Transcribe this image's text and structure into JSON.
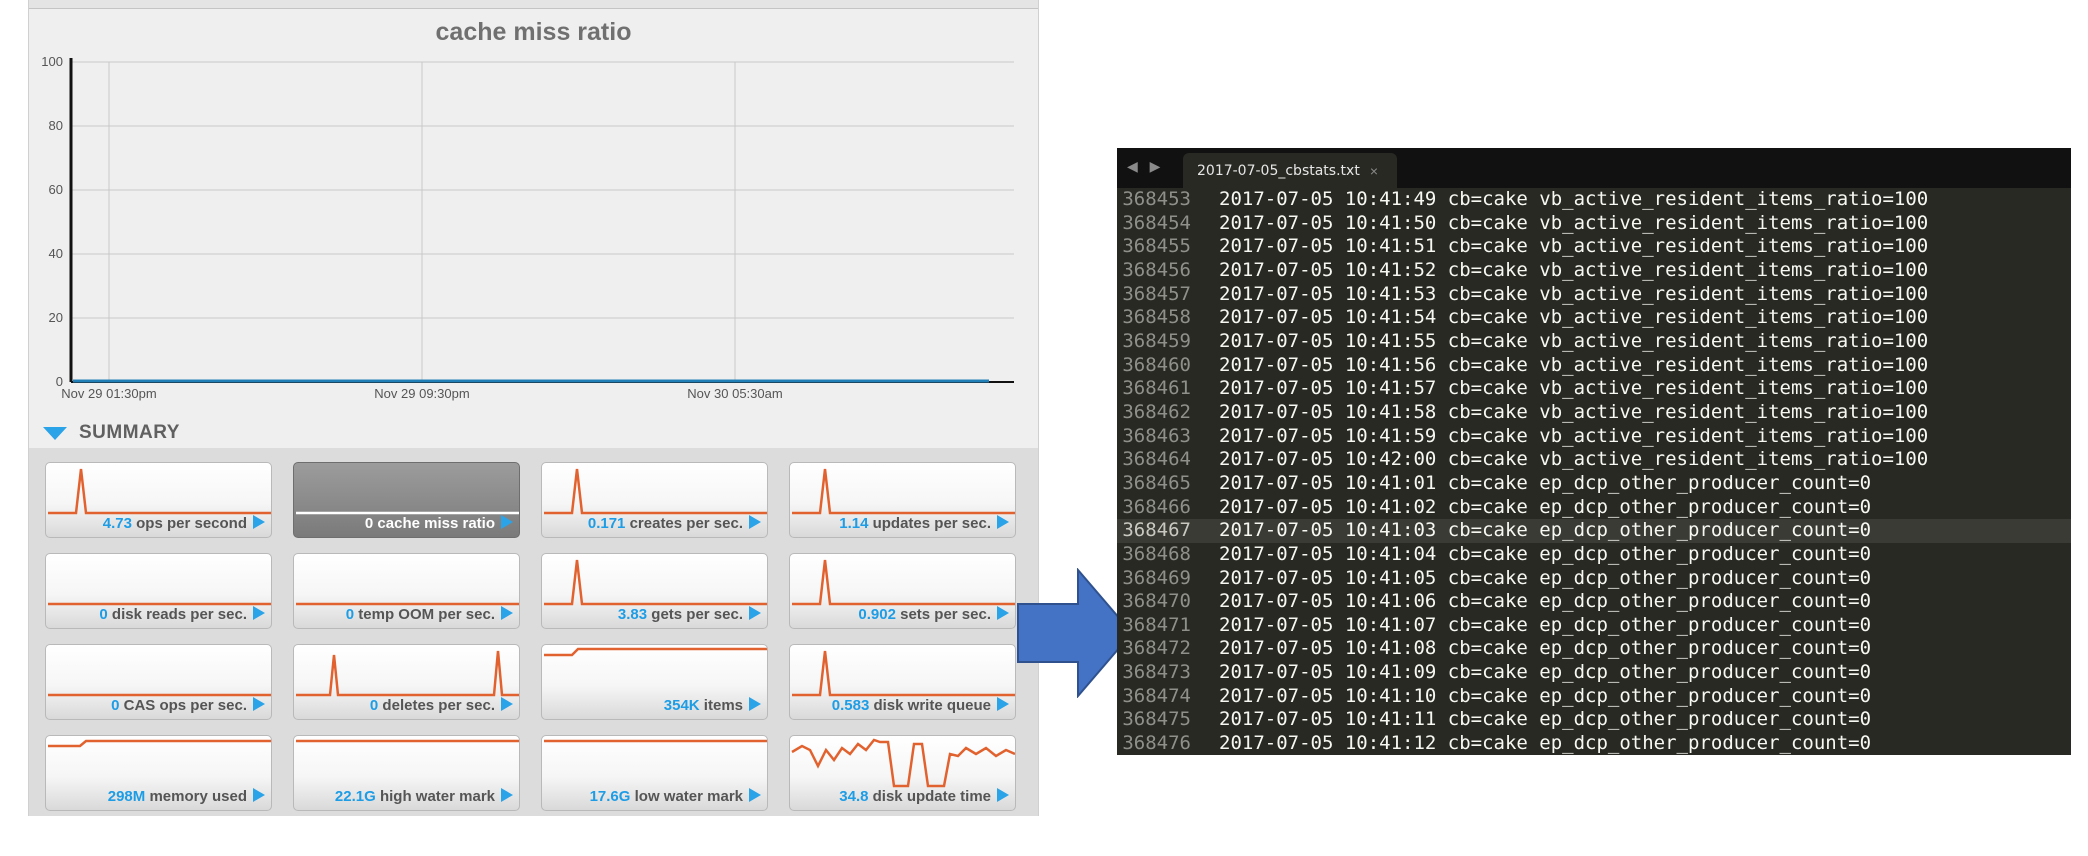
{
  "dashboard": {
    "chart": {
      "title": "cache miss ratio",
      "y_ticks": [
        "100",
        "80",
        "60",
        "40",
        "20",
        "0"
      ],
      "x_ticks": [
        "Nov 29 01:30pm",
        "Nov 29 09:30pm",
        "Nov 30 05:30am"
      ],
      "line_color": "#1f7fb6"
    },
    "chart_data": {
      "type": "line",
      "title": "cache miss ratio",
      "xlabel": "",
      "ylabel": "",
      "ylim": [
        0,
        100
      ],
      "x_tick_labels": [
        "Nov 29 01:30pm",
        "Nov 29 09:30pm",
        "Nov 30 05:30am"
      ],
      "grid": true,
      "series": [
        {
          "values": [
            0,
            0,
            0,
            0,
            0,
            0,
            0,
            0,
            0,
            0,
            0,
            0
          ]
        }
      ]
    },
    "summary": {
      "label": "SUMMARY",
      "accent_color": "#2aa3e8",
      "tiles": [
        {
          "value": "4.73",
          "label": "ops per second",
          "spark": "spike"
        },
        {
          "value": "0",
          "label": "cache miss ratio",
          "spark": "flat",
          "selected": true
        },
        {
          "value": "0.171",
          "label": "creates per sec.",
          "spark": "spike"
        },
        {
          "value": "1.14",
          "label": "updates per sec.",
          "spark": "spike"
        },
        {
          "value": "0",
          "label": "disk reads per sec.",
          "spark": "flat"
        },
        {
          "value": "0",
          "label": "temp OOM per sec.",
          "spark": "flat"
        },
        {
          "value": "3.83",
          "label": "gets per sec.",
          "spark": "spike"
        },
        {
          "value": "0.902",
          "label": "sets per sec.",
          "spark": "spike"
        },
        {
          "value": "0",
          "label": "CAS ops per sec.",
          "spark": "flat"
        },
        {
          "value": "0",
          "label": "deletes per sec.",
          "spark": "double-spike"
        },
        {
          "value": "354K",
          "label": "items",
          "spark": "step-high"
        },
        {
          "value": "0.583",
          "label": "disk write queue",
          "spark": "spike"
        },
        {
          "value": "298M",
          "label": "memory used",
          "spark": "step-mid"
        },
        {
          "value": "22.1G",
          "label": "high water mark",
          "spark": "top-flat"
        },
        {
          "value": "17.6G",
          "label": "low water mark",
          "spark": "top-flat"
        },
        {
          "value": "34.8",
          "label": "disk update time",
          "spark": "noisy"
        }
      ]
    }
  },
  "editor": {
    "nav_arrows": "◀ ▶",
    "tab": {
      "filename": "2017-07-05_cbstats.txt",
      "close": "×"
    },
    "current_line": "368467",
    "lines": [
      {
        "n": "368453",
        "text": "2017-07-05 10:41:49 cb=cake vb_active_resident_items_ratio=100"
      },
      {
        "n": "368454",
        "text": "2017-07-05 10:41:50 cb=cake vb_active_resident_items_ratio=100"
      },
      {
        "n": "368455",
        "text": "2017-07-05 10:41:51 cb=cake vb_active_resident_items_ratio=100"
      },
      {
        "n": "368456",
        "text": "2017-07-05 10:41:52 cb=cake vb_active_resident_items_ratio=100"
      },
      {
        "n": "368457",
        "text": "2017-07-05 10:41:53 cb=cake vb_active_resident_items_ratio=100"
      },
      {
        "n": "368458",
        "text": "2017-07-05 10:41:54 cb=cake vb_active_resident_items_ratio=100"
      },
      {
        "n": "368459",
        "text": "2017-07-05 10:41:55 cb=cake vb_active_resident_items_ratio=100"
      },
      {
        "n": "368460",
        "text": "2017-07-05 10:41:56 cb=cake vb_active_resident_items_ratio=100"
      },
      {
        "n": "368461",
        "text": "2017-07-05 10:41:57 cb=cake vb_active_resident_items_ratio=100"
      },
      {
        "n": "368462",
        "text": "2017-07-05 10:41:58 cb=cake vb_active_resident_items_ratio=100"
      },
      {
        "n": "368463",
        "text": "2017-07-05 10:41:59 cb=cake vb_active_resident_items_ratio=100"
      },
      {
        "n": "368464",
        "text": "2017-07-05 10:42:00 cb=cake vb_active_resident_items_ratio=100"
      },
      {
        "n": "368465",
        "text": "2017-07-05 10:41:01 cb=cake ep_dcp_other_producer_count=0"
      },
      {
        "n": "368466",
        "text": "2017-07-05 10:41:02 cb=cake ep_dcp_other_producer_count=0"
      },
      {
        "n": "368467",
        "text": "2017-07-05 10:41:03 cb=cake ep_dcp_other_producer_count=0"
      },
      {
        "n": "368468",
        "text": "2017-07-05 10:41:04 cb=cake ep_dcp_other_producer_count=0"
      },
      {
        "n": "368469",
        "text": "2017-07-05 10:41:05 cb=cake ep_dcp_other_producer_count=0"
      },
      {
        "n": "368470",
        "text": "2017-07-05 10:41:06 cb=cake ep_dcp_other_producer_count=0"
      },
      {
        "n": "368471",
        "text": "2017-07-05 10:41:07 cb=cake ep_dcp_other_producer_count=0"
      },
      {
        "n": "368472",
        "text": "2017-07-05 10:41:08 cb=cake ep_dcp_other_producer_count=0"
      },
      {
        "n": "368473",
        "text": "2017-07-05 10:41:09 cb=cake ep_dcp_other_producer_count=0"
      },
      {
        "n": "368474",
        "text": "2017-07-05 10:41:10 cb=cake ep_dcp_other_producer_count=0"
      },
      {
        "n": "368475",
        "text": "2017-07-05 10:41:11 cb=cake ep_dcp_other_producer_count=0"
      },
      {
        "n": "368476",
        "text": "2017-07-05 10:41:12 cb=cake ep_dcp_other_producer_count=0"
      }
    ]
  },
  "arrow": {
    "color": "#4472c4",
    "border_color": "#2f528f"
  }
}
